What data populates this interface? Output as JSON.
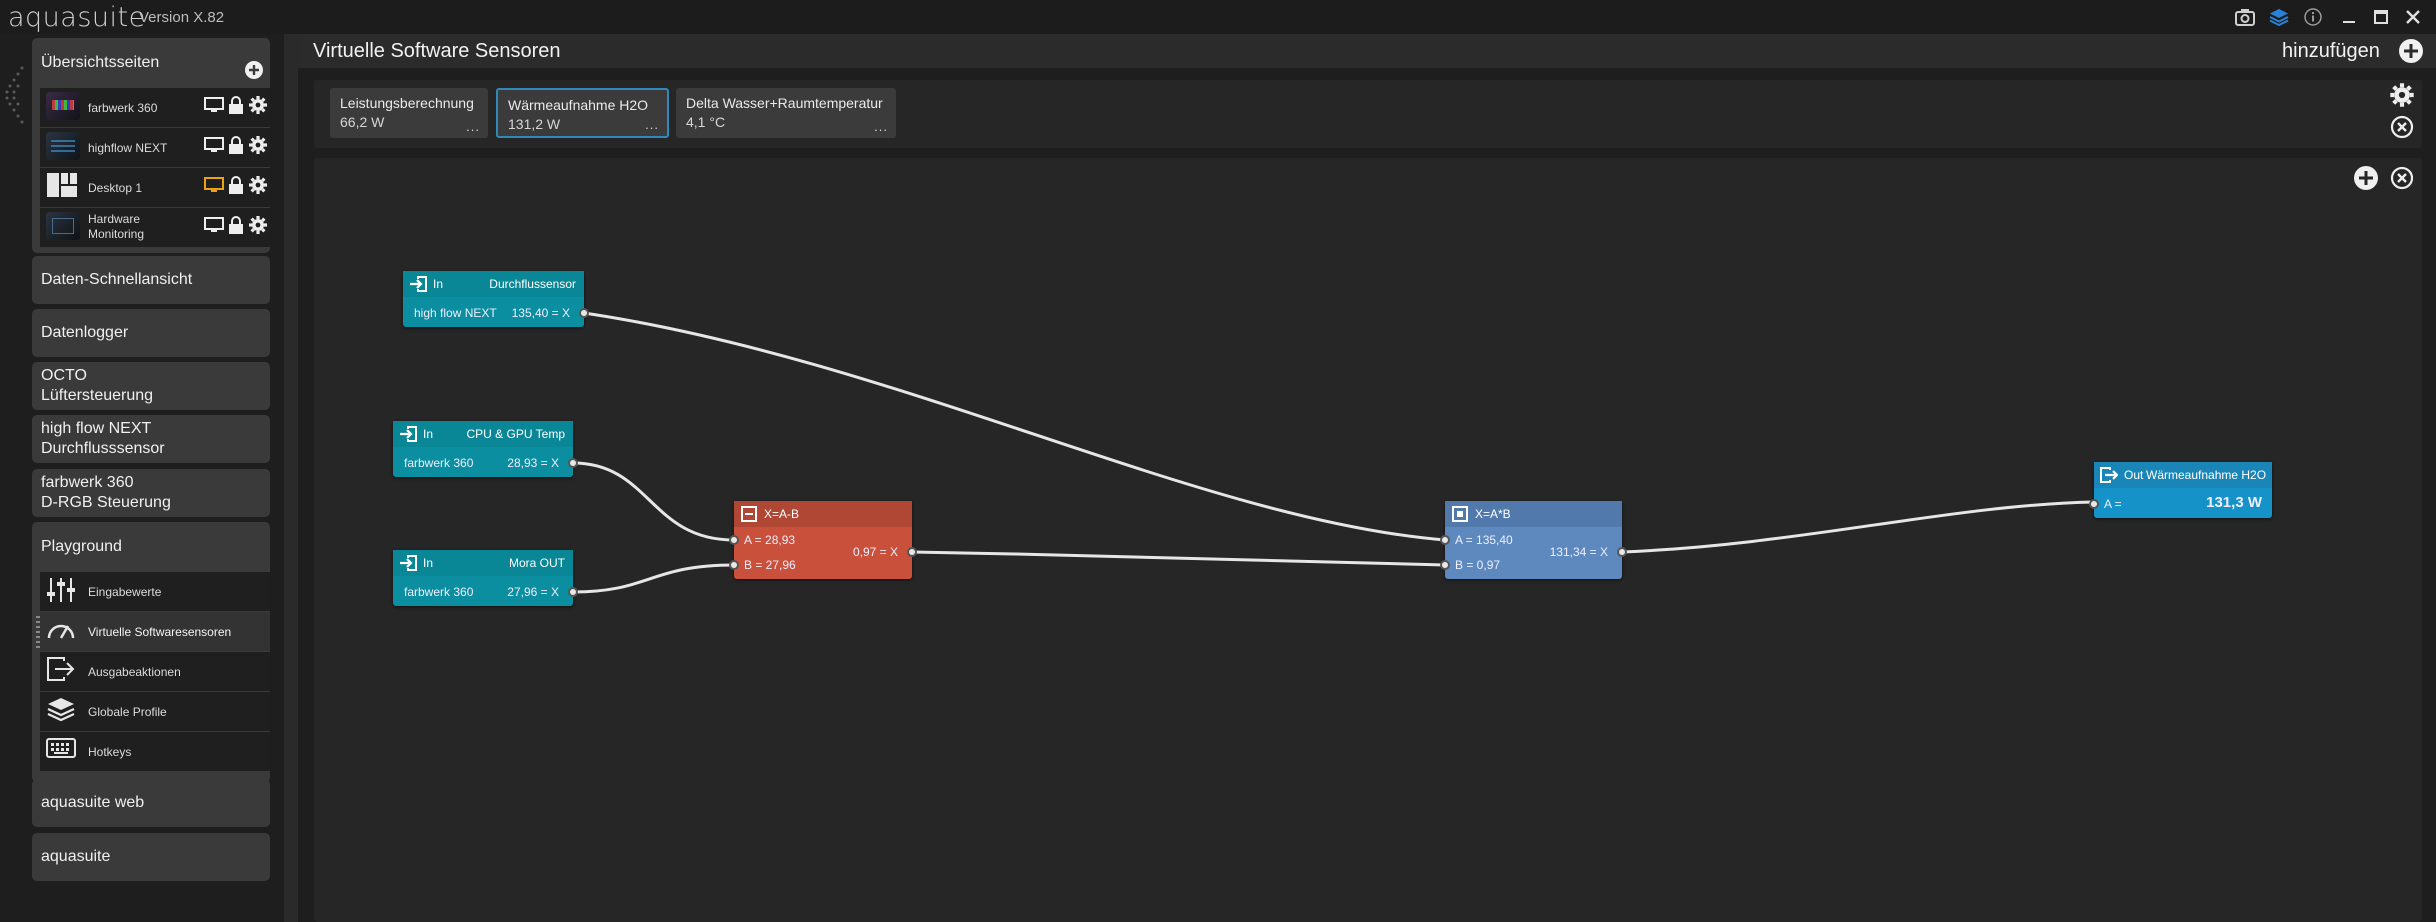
{
  "app": {
    "name": "aquasuite",
    "version": "Version X.82"
  },
  "colors": {
    "accent_blue": "#2e8ab8",
    "input_node": "#0b8ea0",
    "subtract_node": "#c9503b",
    "multiply_node": "#5e89bf",
    "output_node": "#1593c9",
    "highlight_orange": "#e8a317"
  },
  "titlebar_icons": [
    "camera-icon",
    "layers-icon",
    "info-icon",
    "minimize-icon",
    "maximize-icon",
    "close-icon"
  ],
  "sidebar": {
    "overview": {
      "title": "Übersichtsseiten",
      "items": [
        {
          "label": "farbwerk 360",
          "icon": "device-farbwerk-icon"
        },
        {
          "label": "highflow NEXT",
          "icon": "device-highflow-icon"
        },
        {
          "label": "Desktop 1",
          "icon": "desktop-layout-icon"
        },
        {
          "label_line1": "Hardware",
          "label_line2": "Monitoring",
          "icon": "hardware-monitor-icon"
        }
      ]
    },
    "sections": [
      {
        "label": "Daten-Schnellansicht"
      },
      {
        "label": "Datenlogger"
      },
      {
        "line1": "OCTO",
        "line2": "Lüftersteuerung"
      },
      {
        "line1": "high flow NEXT",
        "line2": "Durchflusssensor"
      },
      {
        "line1": "farbwerk 360",
        "line2": "D-RGB Steuerung"
      }
    ],
    "playground": {
      "title": "Playground",
      "items": [
        {
          "label": "Eingabewerte",
          "icon": "sliders-icon"
        },
        {
          "label": "Virtuelle Softwaresensoren",
          "icon": "gauge-icon"
        },
        {
          "label": "Ausgabeaktionen",
          "icon": "output-icon"
        },
        {
          "label": "Globale Profile",
          "icon": "layers-icon"
        },
        {
          "label": "Hotkeys",
          "icon": "keyboard-icon"
        }
      ]
    },
    "bottom": [
      {
        "label": "aquasuite web"
      },
      {
        "label": "aquasuite"
      }
    ]
  },
  "main": {
    "title": "Virtuelle Software Sensoren",
    "add_label": "hinzufügen",
    "sensor_tabs": [
      {
        "name": "Leistungsberechnung",
        "value": "66,2 W",
        "more": "..."
      },
      {
        "name": "Wärmeaufnahme H2O",
        "value": "131,2 W",
        "more": "...",
        "active": true
      },
      {
        "name": "Delta Wasser+Raumtemperatur",
        "value": "4,1 °C",
        "more": "..."
      }
    ]
  },
  "nodes": {
    "in1": {
      "kind": "In",
      "name": "Durchflussensor",
      "device": "high flow NEXT",
      "value": "135,40 = X"
    },
    "in2": {
      "kind": "In",
      "name": "CPU & GPU Temp",
      "device": "farbwerk 360",
      "value": "28,93 = X"
    },
    "in3": {
      "kind": "In",
      "name": "Mora OUT",
      "device": "farbwerk 360",
      "value": "27,96 = X"
    },
    "sub": {
      "formula": "X=A-B",
      "a": "A = 28,93",
      "b": "B = 27,96",
      "result": "0,97 = X"
    },
    "mul": {
      "formula": "X=A*B",
      "a": "A = 135,40",
      "b": "B = 0,97",
      "result": "131,34 = X"
    },
    "out": {
      "kind": "Out",
      "name": "Wärmeaufnahme H2O",
      "a": "A =",
      "value": "131,3 W"
    }
  }
}
